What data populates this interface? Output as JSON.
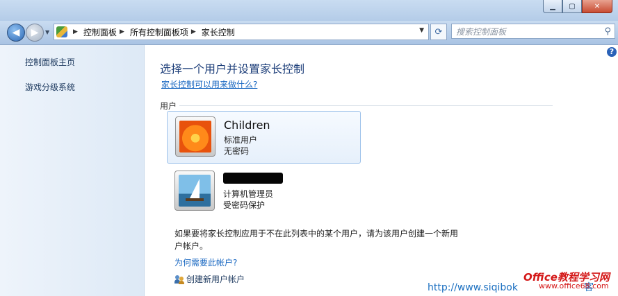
{
  "window": {
    "buttons": {
      "minimize": "▁",
      "maximize": "▢",
      "close": "✕"
    }
  },
  "address": {
    "crumbs": [
      "控制面板",
      "所有控制面板项",
      "家长控制"
    ],
    "search_placeholder": "搜索控制面板"
  },
  "sidebar": {
    "items": [
      {
        "label": "控制面板主页"
      },
      {
        "label": "游戏分级系统"
      }
    ]
  },
  "main": {
    "heading": "选择一个用户并设置家长控制",
    "what_link": "家长控制可以用来做什么?",
    "users_group": "用户",
    "users": [
      {
        "name": "Children",
        "type": "标准用户",
        "password": "无密码",
        "picture": "flower-icon"
      },
      {
        "name": "",
        "type": "计算机管理员",
        "password": "受密码保护",
        "picture": "sailboat-icon"
      }
    ],
    "info_text": "如果要将家长控制应用于不在此列表中的某个用户，请为该用户创建一个新用户帐户。",
    "why_link": "为何需要此帐户?",
    "create_link": "创建新用户帐户"
  },
  "watermark": {
    "url": "http://www.siqibok",
    "suffix": "客",
    "brand": "Office教程学习网",
    "brand_url": "www.office68.com"
  }
}
